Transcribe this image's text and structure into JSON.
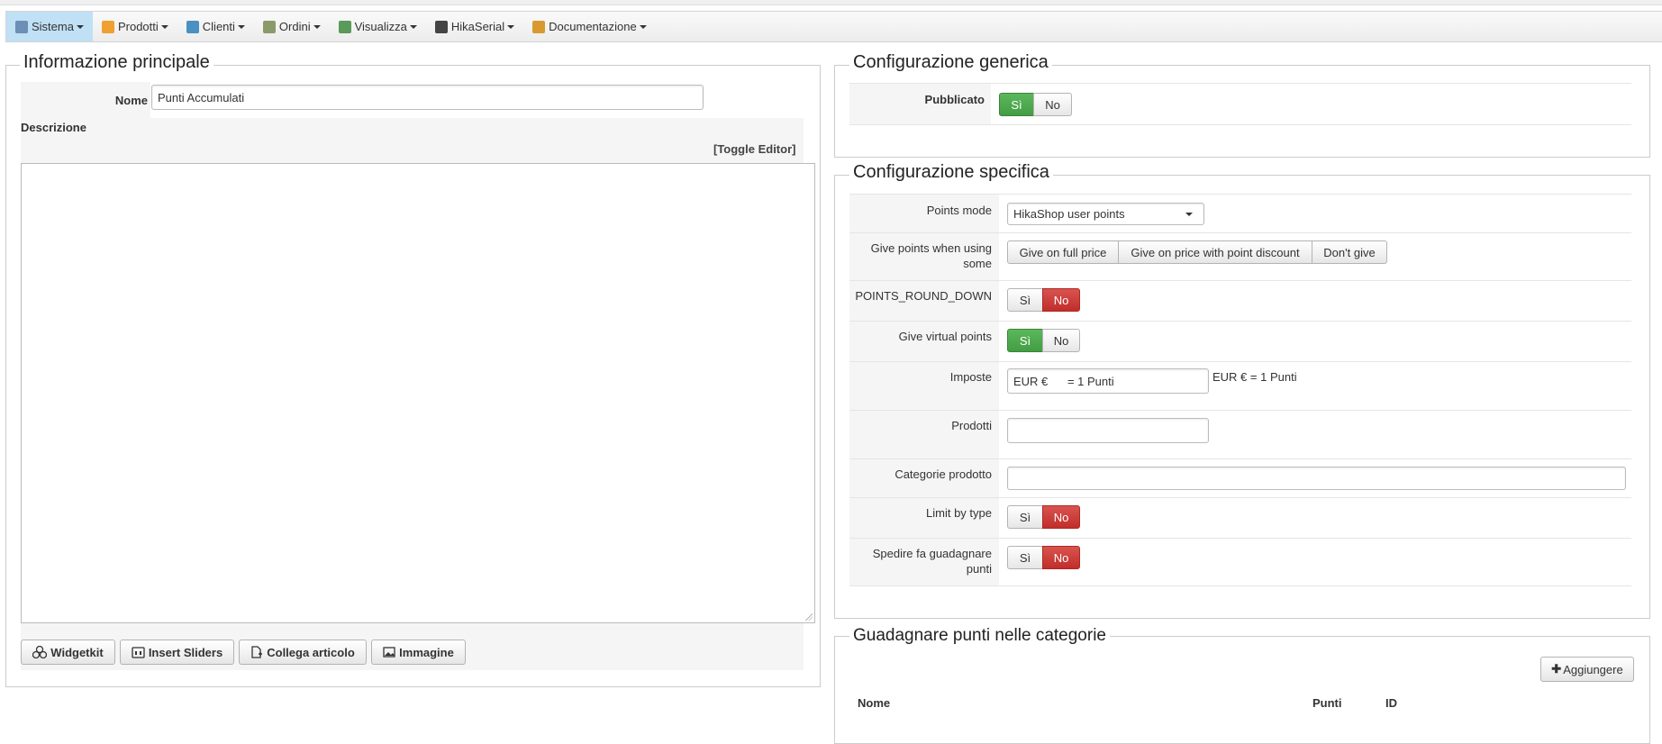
{
  "menu": [
    {
      "label": "Sistema",
      "icon": "tools-icon",
      "active": true
    },
    {
      "label": "Prodotti",
      "icon": "box-icon"
    },
    {
      "label": "Clienti",
      "icon": "users-icon"
    },
    {
      "label": "Ordini",
      "icon": "orders-icon"
    },
    {
      "label": "Visualizza",
      "icon": "display-icon"
    },
    {
      "label": "HikaSerial",
      "icon": "serial-icon"
    },
    {
      "label": "Documentazione",
      "icon": "docs-icon"
    }
  ],
  "main_info": {
    "legend": "Informazione principale",
    "name_label": "Nome",
    "name_value": "Punti Accumulati",
    "description_label": "Descrizione",
    "toggle_editor": "[Toggle Editor]",
    "editor_buttons": [
      {
        "label": "Widgetkit",
        "icon": "widgetkit-icon"
      },
      {
        "label": "Insert Sliders",
        "icon": "sliders-icon"
      },
      {
        "label": "Collega articolo",
        "icon": "link-article-icon"
      },
      {
        "label": "Immagine",
        "icon": "image-icon"
      }
    ]
  },
  "generic_config": {
    "legend": "Configurazione generica",
    "published_label": "Pubblicato",
    "yes": "Sì",
    "no": "No"
  },
  "specific_config": {
    "legend": "Configurazione specifica",
    "points_mode_label": "Points mode",
    "points_mode_value": "HikaShop user points",
    "give_points_label": "Give points when using some",
    "give_points_options": [
      "Give on full price",
      "Give on price with point discount",
      "Don't give"
    ],
    "round_down_label": "POINTS_ROUND_DOWN",
    "virtual_points_label": "Give virtual points",
    "taxes_label": "Imposte",
    "taxes_input_value": "EUR €      = 1 Punti",
    "taxes_text": "EUR € = 1 Punti",
    "products_label": "Prodotti",
    "categories_label": "Categorie prodotto",
    "limit_type_label": "Limit by type",
    "shipping_label": "Spedire fa guadagnare punti",
    "yes": "Sì",
    "no": "No"
  },
  "earn_categories": {
    "legend": "Guadagnare punti nelle categorie",
    "add_button": "Aggiungere",
    "columns": [
      "Nome",
      "Punti",
      "ID"
    ]
  },
  "colors": {
    "active_green": "#5cb85c",
    "active_red": "#d9534f",
    "menu_active": "#bfe0f5"
  }
}
